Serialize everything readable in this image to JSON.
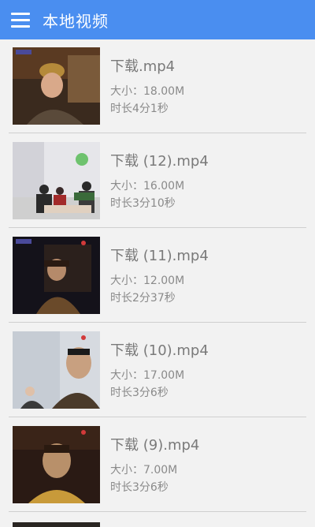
{
  "header": {
    "title": "本地视频",
    "menu_icon": "menu-icon"
  },
  "videos": [
    {
      "name": "下载.mp4",
      "size": "大小：18.00M",
      "duration": "时长4分1秒"
    },
    {
      "name": "下载 (12).mp4",
      "size": "大小：16.00M",
      "duration": "时长3分10秒"
    },
    {
      "name": "下载 (11).mp4",
      "size": "大小：12.00M",
      "duration": "时长2分37秒"
    },
    {
      "name": "下载 (10).mp4",
      "size": "大小：17.00M",
      "duration": "时长3分6秒"
    },
    {
      "name": "下载 (9).mp4",
      "size": "大小：7.00M",
      "duration": "时长3分6秒"
    }
  ],
  "colors": {
    "appbar": "#4a8ef0",
    "background": "#f2f2f2",
    "text": "#8a8a8a"
  }
}
